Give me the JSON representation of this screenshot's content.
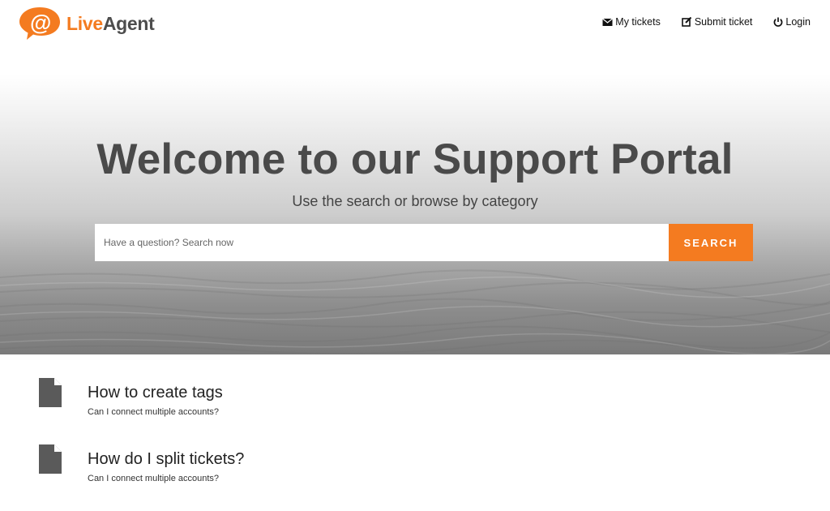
{
  "header": {
    "logo": {
      "part1": "Live",
      "part2": "Agent"
    },
    "nav": [
      {
        "label": "My tickets",
        "icon": "envelope-icon"
      },
      {
        "label": "Submit ticket",
        "icon": "edit-icon"
      },
      {
        "label": "Login",
        "icon": "power-icon"
      }
    ]
  },
  "hero": {
    "title": "Welcome to our Support Portal",
    "subtitle": "Use the search or browse by category",
    "search": {
      "placeholder": "Have a question? Search now",
      "value": "",
      "button_label": "SEARCH"
    }
  },
  "articles": [
    {
      "title": "How to create tags",
      "description": "Can I connect multiple accounts?",
      "icon": "document-icon"
    },
    {
      "title": "How do I split tickets?",
      "description": "Can I connect multiple accounts?",
      "icon": "document-icon"
    }
  ],
  "colors": {
    "accent": "#f47b20",
    "logo_dark": "#4d4d4d",
    "title": "#4a4a4a",
    "icon": "#5a5a5a"
  }
}
